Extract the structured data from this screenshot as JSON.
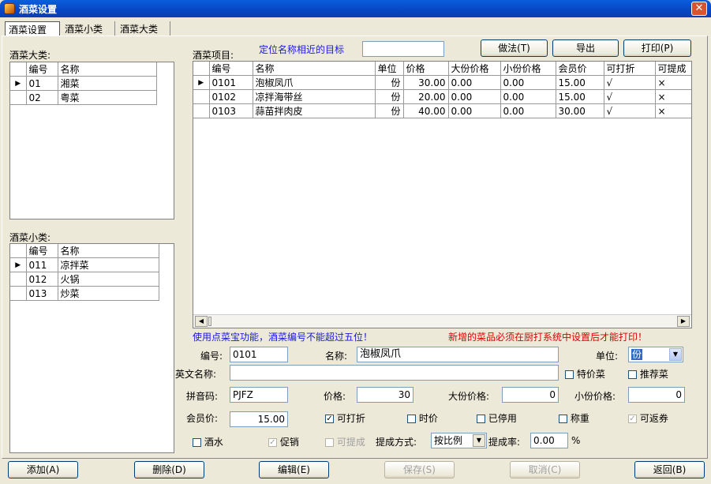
{
  "window": {
    "title": "酒菜设置",
    "close_label": "✕"
  },
  "tabs": [
    {
      "label": "酒菜设置"
    },
    {
      "label": "酒菜小类"
    },
    {
      "label": "酒菜大类"
    }
  ],
  "major": {
    "label": "酒菜大类:",
    "headers": [
      "编号",
      "名称"
    ],
    "rows": [
      {
        "code": "01",
        "name": "湘菜"
      },
      {
        "code": "02",
        "name": "粤菜"
      }
    ]
  },
  "minor": {
    "label": "酒菜小类:",
    "headers": [
      "编号",
      "名称"
    ],
    "rows": [
      {
        "code": "011",
        "name": "凉拌菜"
      },
      {
        "code": "012",
        "name": "火锅"
      },
      {
        "code": "013",
        "name": "炒菜"
      }
    ]
  },
  "items": {
    "label": "酒菜项目:",
    "locate_label": "定位名称相近的目标",
    "locate_value": "",
    "headers": [
      "编号",
      "名称",
      "单位",
      "价格",
      "大份价格",
      "小份价格",
      "会员价",
      "可打折",
      "可提成"
    ],
    "rows": [
      {
        "code": "0101",
        "name": "泡椒凤爪",
        "unit": "份",
        "price": "30.00",
        "large": "0.00",
        "small": "0.00",
        "member": "15.00",
        "discount": "√",
        "commission": "×"
      },
      {
        "code": "0102",
        "name": "凉拌海带丝",
        "unit": "份",
        "price": "20.00",
        "large": "0.00",
        "small": "0.00",
        "member": "15.00",
        "discount": "√",
        "commission": "×"
      },
      {
        "code": "0103",
        "name": "蒜苗拌肉皮",
        "unit": "份",
        "price": "40.00",
        "large": "0.00",
        "small": "0.00",
        "member": "30.00",
        "discount": "√",
        "commission": "×"
      }
    ]
  },
  "toolbar": {
    "method": "做法(T)",
    "export": "导出",
    "print": "打印(P)"
  },
  "notes": {
    "blue": "使用点菜宝功能，酒菜编号不能超过五位！",
    "red": "新增的菜品必须在厨打系统中设置后才能打印！"
  },
  "form": {
    "code_label": "编号:",
    "code_value": "0101",
    "name_label": "名称:",
    "name_value": "泡椒凤爪",
    "unit_label": "单位:",
    "unit_value": "份",
    "english_label": "英文名称:",
    "english_value": "",
    "special_label": "特价菜",
    "recommend_label": "推荐菜",
    "pinyin_label": "拼音码:",
    "pinyin_value": "PJFZ",
    "price_label": "价格:",
    "price_value": "30",
    "large_label": "大份价格:",
    "large_value": "0",
    "small_label": "小份价格:",
    "small_value": "0",
    "member_label": "会员价:",
    "member_value": "15.00",
    "discount_label": "可打折",
    "seasonal_label": "时价",
    "disabled_label": "已停用",
    "weigh_label": "称重",
    "coupon_label": "可返券",
    "drink_label": "酒水",
    "promo_label": "促销",
    "commission_label": "可提成",
    "method_label": "提成方式:",
    "method_value": "按比例",
    "rate_label": "提成率:",
    "rate_value": "0.00",
    "percent": "%",
    "checked": {
      "discount": true,
      "promo": true,
      "coupon": true
    }
  },
  "buttons": {
    "add": "添加(A)",
    "delete": "删除(D)",
    "edit": "编辑(E)",
    "save": "保存(S)",
    "cancel": "取消(C)",
    "back": "返回(B)"
  }
}
